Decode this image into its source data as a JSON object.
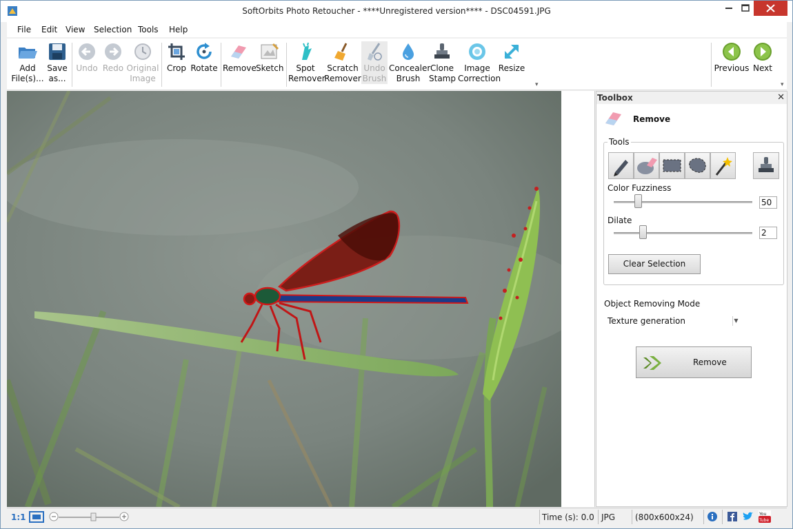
{
  "window": {
    "title": "SoftOrbits Photo Retoucher - ****Unregistered version**** - DSC04591.JPG"
  },
  "menu": [
    "File",
    "Edit",
    "View",
    "Selection",
    "Tools",
    "Help"
  ],
  "toolbar": {
    "add": "Add File(s)...",
    "save": "Save as...",
    "undo": "Undo",
    "redo": "Redo",
    "original": "Original Image",
    "crop": "Crop",
    "rotate": "Rotate",
    "remove": "Remove",
    "sketch": "Sketch",
    "spot": "Spot Remover",
    "scratch": "Scratch Remover",
    "undo_brush": "Undo Brush",
    "concealer": "Concealer Brush",
    "clone": "Clone Stamp",
    "correction": "Image Correction",
    "resize": "Resize",
    "previous": "Previous",
    "next": "Next"
  },
  "toolbox": {
    "header": "Toolbox",
    "close": "✕",
    "tool_name": "Remove",
    "tools_legend": "Tools",
    "color_fuzziness_label": "Color Fuzziness",
    "color_fuzziness_value": "50",
    "dilate_label": "Dilate",
    "dilate_value": "2",
    "clear_selection": "Clear Selection",
    "mode_label": "Object Removing Mode",
    "mode_value": "Texture generation",
    "remove_button": "Remove"
  },
  "status": {
    "zoom_actual": "1:1",
    "time": "Time (s): 0.0",
    "format": "JPG",
    "dimensions": "(800x600x24)"
  },
  "colors": {
    "accent_green": "#6a9a2a",
    "close_red": "#c7362d",
    "selection_red": "#cc1010"
  }
}
